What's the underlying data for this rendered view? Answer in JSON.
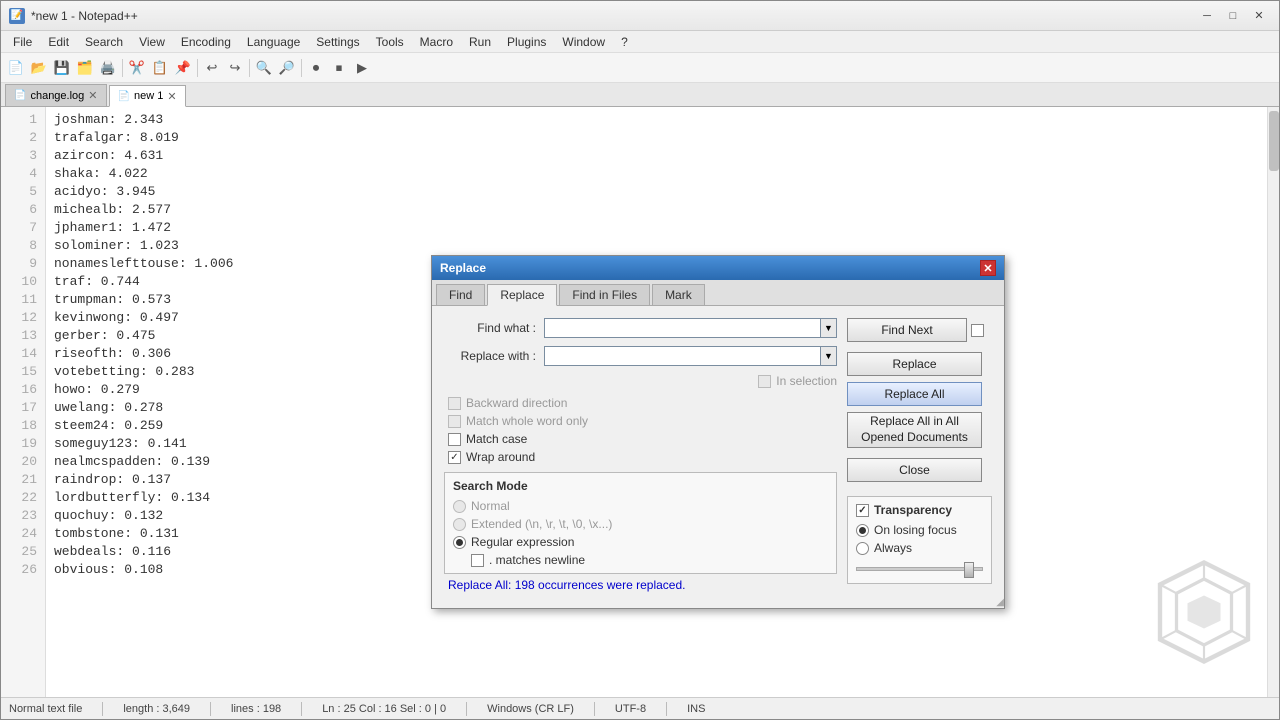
{
  "window": {
    "title": "*new 1 - Notepad++",
    "icon": "📝"
  },
  "titlebar": {
    "title": "*new 1 - Notepad++",
    "minimize": "─",
    "maximize": "□",
    "close": "✕"
  },
  "menubar": {
    "items": [
      "File",
      "Edit",
      "Search",
      "View",
      "Encoding",
      "Language",
      "Settings",
      "Tools",
      "Macro",
      "Run",
      "Plugins",
      "Window",
      "?"
    ]
  },
  "tabs": [
    {
      "label": "change.log",
      "active": false
    },
    {
      "label": "new 1",
      "active": true
    }
  ],
  "editor": {
    "lines": [
      "joshman: 2.343",
      "trafalgar: 8.019",
      "azircon: 4.631",
      "shaka: 4.022",
      "acidyo: 3.945",
      "michealb: 2.577",
      "jphamer1: 1.472",
      "solominer: 1.023",
      "nonameslefttouse: 1.006",
      "traf: 0.744",
      "trumpman: 0.573",
      "kevinwong: 0.497",
      "gerber: 0.475",
      "riseofth: 0.306",
      "votebetting: 0.283",
      "howo: 0.279",
      "uwelang: 0.278",
      "steem24: 0.259",
      "someguy123: 0.141",
      "nealmcspadden: 0.139",
      "raindrop: 0.137",
      "lordbutterfly: 0.134",
      "quochuy: 0.132",
      "tombstone: 0.131",
      "webdeals: 0.116",
      "obvious: 0.108"
    ]
  },
  "statusbar": {
    "file_type": "Normal text file",
    "length": "length : 3,649",
    "lines": "lines : 198",
    "position": "Ln : 25   Col : 16   Sel : 0 | 0",
    "line_endings": "Windows (CR LF)",
    "encoding": "UTF-8",
    "mode": "INS"
  },
  "dialog": {
    "title": "Replace",
    "close_btn": "✕",
    "tabs": [
      "Find",
      "Replace",
      "Find in Files",
      "Mark"
    ],
    "active_tab": 1,
    "find_what_label": "Find what :",
    "find_what_value": "",
    "replace_with_label": "Replace with :",
    "replace_with_value": "",
    "in_selection_label": "In selection",
    "checkboxes": {
      "backward_direction": {
        "label": "Backward direction",
        "checked": false,
        "disabled": true
      },
      "match_whole_word": {
        "label": "Match whole word only",
        "checked": false,
        "disabled": true
      },
      "match_case": {
        "label": "Match case",
        "checked": false,
        "disabled": false
      },
      "wrap_around": {
        "label": "Wrap around",
        "checked": true,
        "disabled": false
      }
    },
    "buttons": {
      "find_next": "Find Next",
      "replace": "Replace",
      "replace_all": "Replace All",
      "replace_all_in_all": "Replace All in All Opened Documents",
      "close": "Close"
    },
    "search_mode": {
      "title": "Search Mode",
      "options": [
        "Normal",
        "Extended (\\n, \\r, \\t, \\0, \\x...)",
        "Regular expression"
      ],
      "selected": 2,
      "matches_newline_label": ". matches newline"
    },
    "transparency": {
      "title": "Transparency",
      "enabled": true,
      "on_losing_focus": "On losing focus",
      "always": "Always",
      "selected": "on_losing_focus"
    },
    "status_message": "Replace All: 198 occurrences were replaced."
  }
}
